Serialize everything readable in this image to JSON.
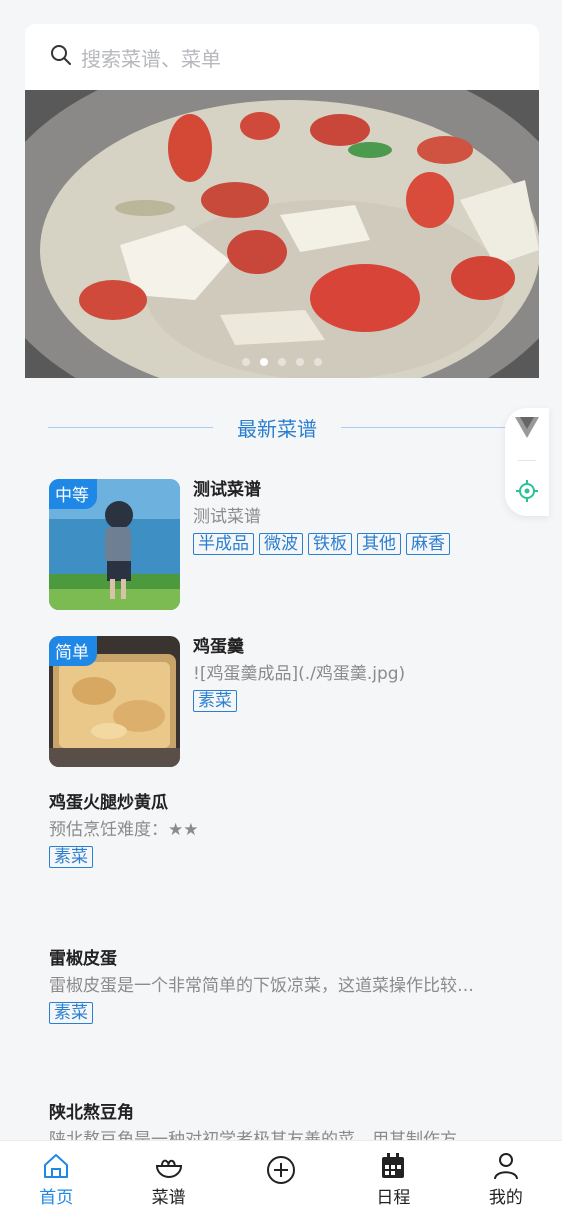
{
  "search": {
    "placeholder": "搜索菜谱、菜单"
  },
  "banner": {
    "dot_count": 5,
    "active_index": 1
  },
  "section": {
    "title": "最新菜谱"
  },
  "recipes": [
    {
      "title": "测试菜谱",
      "desc": "测试菜谱",
      "level": "中等",
      "tags": [
        "半成品",
        "微波",
        "铁板",
        "其他",
        "麻香"
      ]
    },
    {
      "title": "鸡蛋羹",
      "desc": "![鸡蛋羹成品](./鸡蛋羹.jpg)",
      "level": "简单",
      "tags": [
        "素菜"
      ]
    },
    {
      "title": "鸡蛋火腿炒黄瓜",
      "desc": "预估烹饪难度：★★",
      "tags": [
        "素菜"
      ]
    },
    {
      "title": "雷椒皮蛋",
      "desc": "雷椒皮蛋是一个非常简单的下饭凉菜，这道菜操作比较…",
      "tags": [
        "素菜"
      ]
    },
    {
      "title": "陕北熬豆角",
      "desc": "陕北熬豆角是一种对初学者极其友善的菜，用其制作方"
    }
  ],
  "tabbar": {
    "items": [
      {
        "label": "首页",
        "icon": "home-icon",
        "active": true
      },
      {
        "label": "菜谱",
        "icon": "bowl-icon"
      },
      {
        "label": "",
        "icon": "add-circle-icon"
      },
      {
        "label": "日程",
        "icon": "calendar-icon"
      },
      {
        "label": "我的",
        "icon": "user-icon"
      }
    ]
  },
  "colors": {
    "accent": "#1f87e6",
    "tag": "#2a7fd0",
    "background": "#f5f6f8"
  }
}
